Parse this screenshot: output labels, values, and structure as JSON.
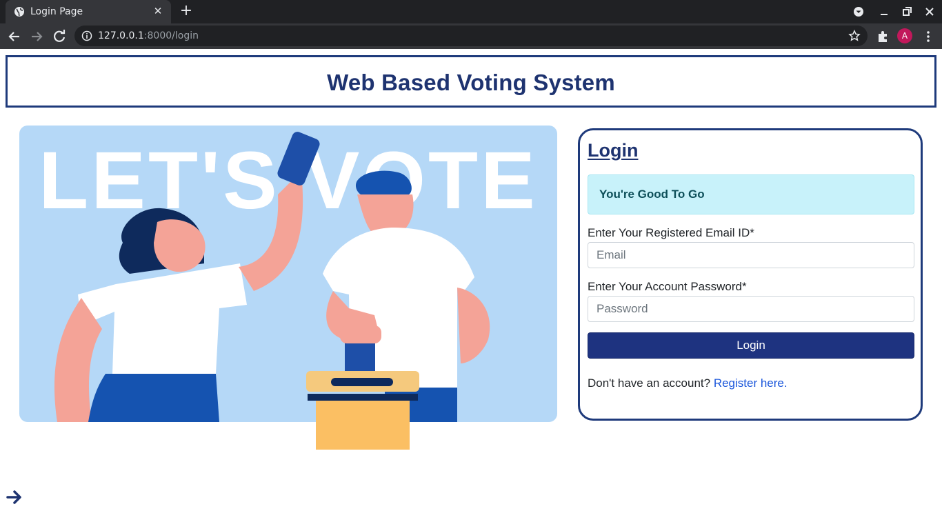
{
  "browser": {
    "tab_title": "Login Page",
    "url_host": "127.0.0.1",
    "url_path": ":8000/login",
    "profile_initial": "A",
    "icons": [
      "globe-icon",
      "close-icon",
      "plus-icon",
      "back-icon",
      "forward-icon",
      "reload-icon",
      "info-icon",
      "star-icon",
      "extensions-icon",
      "menu-icon",
      "minimize-icon",
      "restore-icon",
      "window-close-icon",
      "tab-search-icon"
    ]
  },
  "header": {
    "title": "Web Based Voting System"
  },
  "hero": {
    "banner_text": "LET'S VOTE"
  },
  "login": {
    "heading": "Login",
    "alert_message": "You're Good To Go",
    "email_label": "Enter Your Registered Email ID*",
    "email_placeholder": "Email",
    "email_value": "",
    "password_label": "Enter Your Account Password*",
    "password_placeholder": "Password",
    "password_value": "",
    "submit_label": "Login",
    "register_prompt": "Don't have an account?",
    "register_link": "Register here."
  },
  "colors": {
    "brand_navy": "#1e3370",
    "button": "#1e3380",
    "alert_bg": "#c8f2fa",
    "link": "#1a56db",
    "hero_bg": "#b5d8f7"
  }
}
